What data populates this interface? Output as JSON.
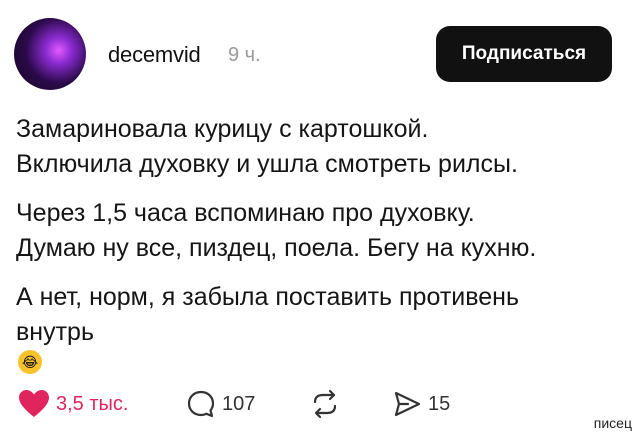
{
  "header": {
    "username": "decemvid",
    "timestamp": "9 ч.",
    "subscribe_label": "Подписаться"
  },
  "post": {
    "paragraphs": [
      [
        "Замариновала курицу с картошкой.",
        "Включила духовку и ушла смотреть рилсы."
      ],
      [
        "Через 1,5 часа вспоминаю про духовку.",
        "Думаю ну все, пиздец, поела. Бегу на кухню."
      ],
      [
        "А нет, норм, я забыла поставить противень",
        "внутрь"
      ]
    ],
    "emoji": "rolling-on-floor-laughing"
  },
  "actions": {
    "likes": "3,5 тыс.",
    "comments": "107",
    "reposts": "",
    "shares": "15",
    "like_color": "#e0245e"
  },
  "watermark": "писец",
  "icons": [
    "heart-icon",
    "comment-icon",
    "repost-icon",
    "share-icon"
  ]
}
